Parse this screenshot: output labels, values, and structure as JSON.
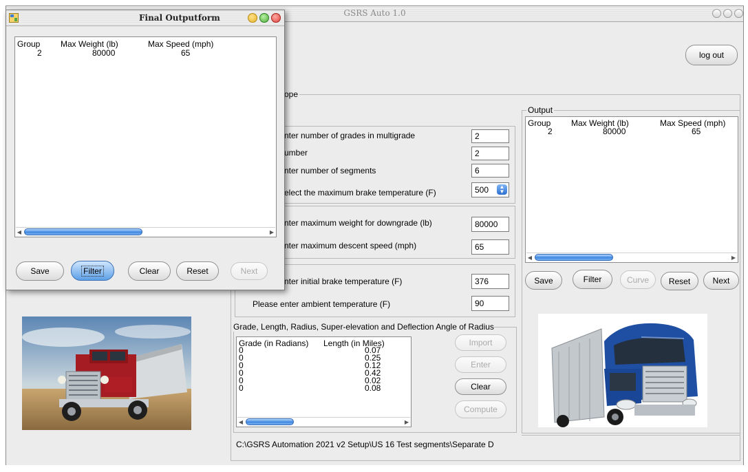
{
  "main_window": {
    "title": "GSRS Auto 1.0",
    "logout_label": "log out",
    "top_group_label": "ope",
    "inputs": {
      "grades_label": "nter number of grades in multigrade",
      "grades_value": "2",
      "number_label": "umber",
      "number_value": "2",
      "segments_label": "nter number of segments",
      "segments_value": "6",
      "brake_temp_max_label": "elect the maximum brake temperature (F)",
      "brake_temp_max_value": "500"
    },
    "downgrade": {
      "max_weight_label": "nter maximum weight for downgrade (lb)",
      "max_weight_value": "80000",
      "max_speed_label": "nter maximum descent speed (mph)",
      "max_speed_value": "65"
    },
    "temperature": {
      "initial_label": "nter initial brake temperature (F)",
      "initial_value": "376",
      "ambient_label": "Please enter ambient temperature (F)",
      "ambient_value": "90"
    },
    "segments_group": {
      "label": "Grade, Length, Radius, Super-elevation and Deflection Angle of Radius",
      "columns": [
        "Grade (in Radians)",
        "Length (in Miles)"
      ],
      "rows": [
        {
          "grade": "0",
          "length": "0.07"
        },
        {
          "grade": "0",
          "length": "0.25"
        },
        {
          "grade": "0",
          "length": "0.12"
        },
        {
          "grade": "0",
          "length": "0.42"
        },
        {
          "grade": "0",
          "length": "0.02"
        },
        {
          "grade": "0",
          "length": "0.08"
        }
      ],
      "buttons": {
        "import": "Import",
        "enter": "Enter",
        "clear": "Clear",
        "compute": "Compute"
      }
    },
    "file_path": "C:\\GSRS Automation 2021 v2  Setup\\US 16 Test segments\\Separate D",
    "output": {
      "label": "Output",
      "columns": [
        "Group",
        "Max Weight (lb)",
        "Max Speed (mph)"
      ],
      "row": {
        "group": "2",
        "weight": "80000",
        "speed": "65"
      },
      "buttons": {
        "save": "Save",
        "filter": "Filter",
        "curve": "Curve",
        "reset": "Reset",
        "next": "Next"
      }
    }
  },
  "final_form": {
    "title": "Final Outputform",
    "columns": [
      "Group",
      "Max Weight (lb)",
      "Max Speed (mph)"
    ],
    "row": {
      "group": "2",
      "weight": "80000",
      "speed": "65"
    },
    "buttons": {
      "save": "Save",
      "filter": "Filter",
      "clear": "Clear",
      "reset": "Reset",
      "next": "Next"
    }
  },
  "colors": {
    "window_bg": "#ececec",
    "close_red": "#e0443e",
    "minimize_yellow": "#e7b52a",
    "zoom_green": "#4fae3c",
    "active_button_blue": "#5d9fe6"
  }
}
